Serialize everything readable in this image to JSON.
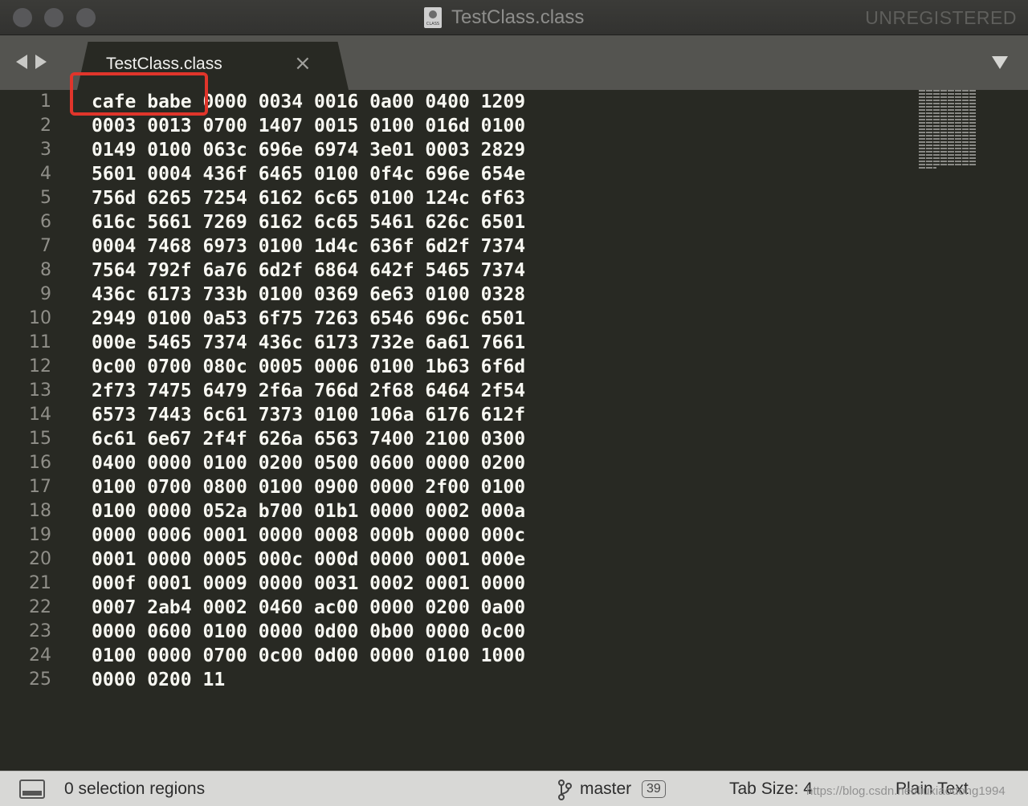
{
  "window": {
    "title": "TestClass.class",
    "file_icon_label": "CLASS",
    "license_status": "UNREGISTERED"
  },
  "tabs": [
    {
      "label": "TestClass.class",
      "close_glyph": "×",
      "active": true
    }
  ],
  "editor": {
    "line_numbers": [
      "1",
      "2",
      "3",
      "4",
      "5",
      "6",
      "7",
      "8",
      "9",
      "10",
      "11",
      "12",
      "13",
      "14",
      "15",
      "16",
      "17",
      "18",
      "19",
      "20",
      "21",
      "22",
      "23",
      "24",
      "25"
    ],
    "lines": [
      "cafe babe 0000 0034 0016 0a00 0400 1209",
      "0003 0013 0700 1407 0015 0100 016d 0100",
      "0149 0100 063c 696e 6974 3e01 0003 2829",
      "5601 0004 436f 6465 0100 0f4c 696e 654e",
      "756d 6265 7254 6162 6c65 0100 124c 6f63",
      "616c 5661 7269 6162 6c65 5461 626c 6501",
      "0004 7468 6973 0100 1d4c 636f 6d2f 7374",
      "7564 792f 6a76 6d2f 6864 642f 5465 7374",
      "436c 6173 733b 0100 0369 6e63 0100 0328",
      "2949 0100 0a53 6f75 7263 6546 696c 6501",
      "000e 5465 7374 436c 6173 732e 6a61 7661",
      "0c00 0700 080c 0005 0006 0100 1b63 6f6d",
      "2f73 7475 6479 2f6a 766d 2f68 6464 2f54",
      "6573 7443 6c61 7373 0100 106a 6176 612f",
      "6c61 6e67 2f4f 626a 6563 7400 2100 0300",
      "0400 0000 0100 0200 0500 0600 0000 0200",
      "0100 0700 0800 0100 0900 0000 2f00 0100",
      "0100 0000 052a b700 01b1 0000 0002 000a",
      "0000 0006 0001 0000 0008 000b 0000 000c",
      "0001 0000 0005 000c 000d 0000 0001 000e",
      "000f 0001 0009 0000 0031 0002 0001 0000",
      "0007 2ab4 0002 0460 ac00 0000 0200 0a00",
      "0000 0600 0100 0000 0d00 0b00 0000 0c00",
      "0100 0000 0700 0c00 0d00 0000 0100 1000",
      "0000 0200 11"
    ],
    "highlight_color": "#e0352b"
  },
  "statusbar": {
    "selection": "0 selection regions",
    "branch": "master",
    "branch_badge": "39",
    "tab_size": "Tab Size: 4",
    "syntax": "Plain Text",
    "watermark": "https://blog.csdn.net/liuxiaodong1994"
  },
  "colors": {
    "editor_bg": "#282923",
    "text": "#f8f8f2",
    "line_number": "#908f89",
    "statusbar_bg": "#d8d8d6"
  },
  "icons": [
    "close-icon",
    "back-arrow-icon",
    "forward-arrow-icon",
    "tab-menu-icon",
    "panel-toggle-icon",
    "git-branch-icon",
    "class-file-icon"
  ]
}
